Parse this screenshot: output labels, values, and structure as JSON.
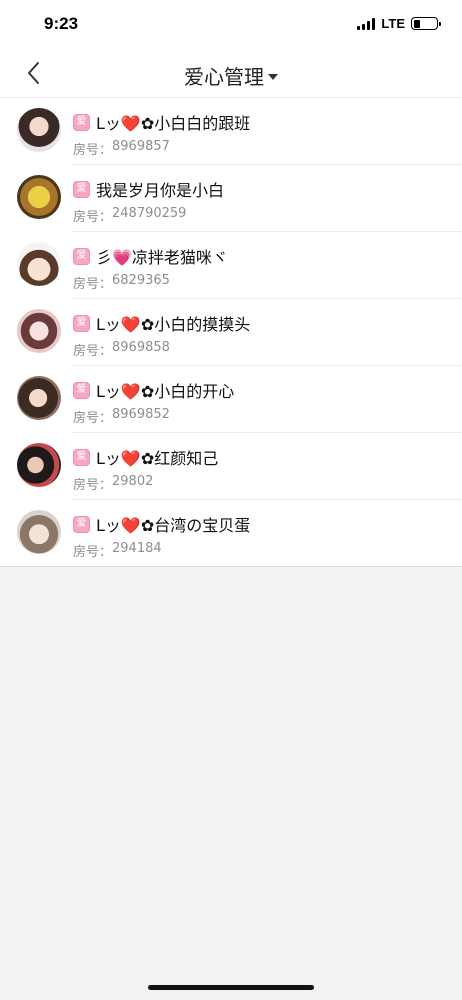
{
  "status": {
    "time": "9:23",
    "network": "LTE"
  },
  "header": {
    "title": "爱心管理"
  },
  "badge_char": "爱",
  "room_prefix": "房号：",
  "rooms": [
    {
      "name": "Lッ❤️✿小白白的跟班",
      "room": "8969857"
    },
    {
      "name": "我是岁月你是小白",
      "room": "248790259"
    },
    {
      "name": "彡💗凉拌老猫咪ヾ",
      "room": "6829365"
    },
    {
      "name": "Lッ❤️✿小白的摸摸头",
      "room": "8969858"
    },
    {
      "name": "Lッ❤️✿小白的开心",
      "room": "8969852"
    },
    {
      "name": "Lッ❤️✿红颜知己",
      "room": "29802"
    },
    {
      "name": "Lッ❤️✿台湾の宝贝蛋",
      "room": "294184"
    }
  ]
}
